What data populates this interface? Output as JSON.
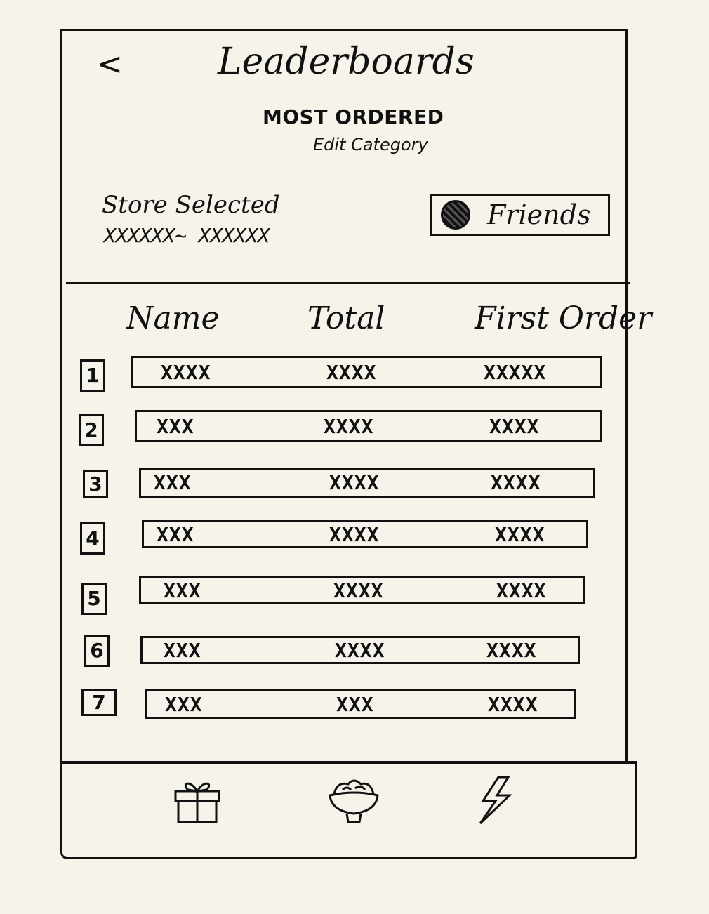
{
  "header": {
    "back_icon": "chevron-left-icon",
    "back_glyph": "<",
    "title": "Leaderboards"
  },
  "category": {
    "title": "MOST ORDERED",
    "edit_label": "Edit Category"
  },
  "store": {
    "label": "Store Selected",
    "value": "XXXXXX~ XXXXXX"
  },
  "friends": {
    "label": "Friends",
    "selected": true
  },
  "table": {
    "columns": [
      "Name",
      "Total",
      "First Order"
    ],
    "rows": [
      {
        "rank": "1",
        "name": "XXXX",
        "total": "XXXX",
        "first_order": "XXXXX"
      },
      {
        "rank": "2",
        "name": "XXX",
        "total": "XXXX",
        "first_order": "XXXX"
      },
      {
        "rank": "3",
        "name": "XXX",
        "total": "XXXX",
        "first_order": "XXXX"
      },
      {
        "rank": "4",
        "name": "XXX",
        "total": "XXXX",
        "first_order": "XXXX"
      },
      {
        "rank": "5",
        "name": "XXX",
        "total": "XXXX",
        "first_order": "XXXX"
      },
      {
        "rank": "6",
        "name": "XXX",
        "total": "XXXX",
        "first_order": "XXXX"
      },
      {
        "rank": "7",
        "name": "XXX",
        "total": "XXX",
        "first_order": "XXXX"
      }
    ]
  },
  "bottom_nav": {
    "items": [
      {
        "icon": "gift-icon"
      },
      {
        "icon": "food-bowl-icon"
      },
      {
        "icon": "lightning-icon"
      }
    ]
  }
}
